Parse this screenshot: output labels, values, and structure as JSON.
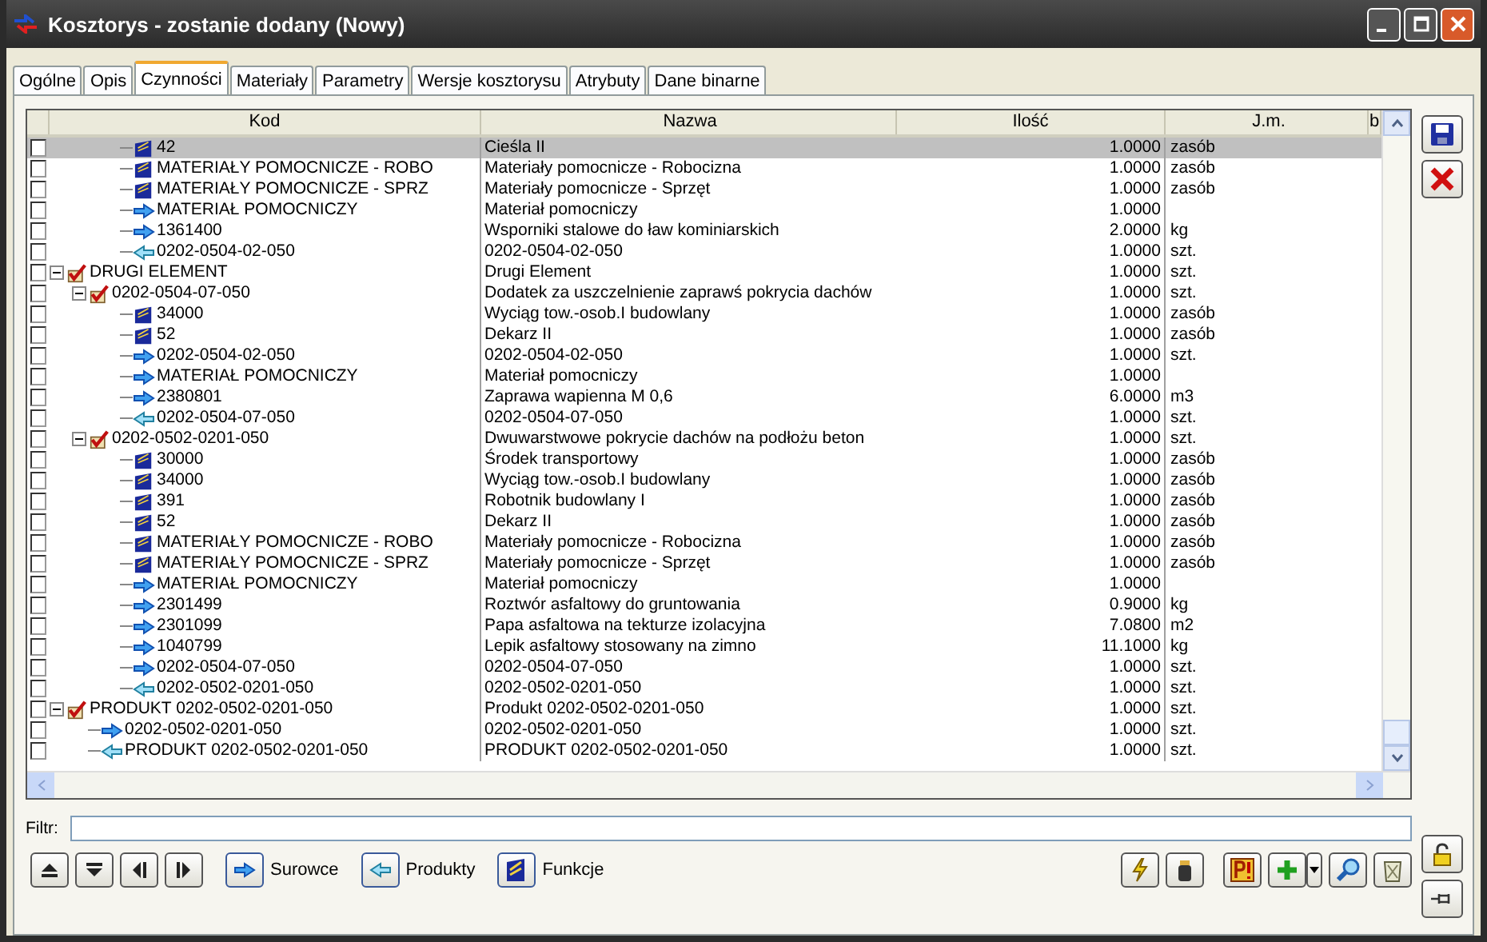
{
  "window": {
    "title": "Kosztorys - zostanie dodany  (Nowy)"
  },
  "tabs": [
    {
      "label": "Ogólne",
      "selected": false
    },
    {
      "label": "Opis",
      "selected": false
    },
    {
      "label": "Czynności",
      "selected": true
    },
    {
      "label": "Materiały",
      "selected": false
    },
    {
      "label": "Parametry",
      "selected": false
    },
    {
      "label": "Wersje kosztorysu",
      "selected": false
    },
    {
      "label": "Atrybuty",
      "selected": false
    },
    {
      "label": "Dane binarne",
      "selected": false
    }
  ],
  "table": {
    "columns": [
      "Kod",
      "Nazwa",
      "Ilość",
      "J.m.",
      "b"
    ],
    "rows": [
      {
        "children": [
          {
            "children": [
              {
                "kind": "resource",
                "kod": "42",
                "nazwa": "Cieśla II",
                "ilosc": "1.0000",
                "jm": "zasób",
                "checked": false,
                "selected": true
              },
              {
                "kind": "resource",
                "kod": "MATERIAŁY POMOCNICZE - ROBO",
                "nazwa": "Materiały pomocnicze - Robocizna",
                "ilosc": "1.0000",
                "jm": "zasób",
                "checked": false,
                "selected": false
              },
              {
                "kind": "resource",
                "kod": "MATERIAŁY POMOCNICZE - SPRZ",
                "nazwa": "Materiały pomocnicze - Sprzęt",
                "ilosc": "1.0000",
                "jm": "zasób",
                "checked": false,
                "selected": false
              },
              {
                "kind": "input",
                "kod": "MATERIAŁ POMOCNICZY",
                "nazwa": "Materiał pomocniczy",
                "ilosc": "1.0000",
                "checked": false,
                "selected": false
              },
              {
                "kind": "input",
                "kod": "1361400",
                "nazwa": "Wsporniki stalowe do ław kominiarskich",
                "ilosc": "2.0000",
                "jm": "kg",
                "checked": false,
                "selected": false
              },
              {
                "kind": "output",
                "kod": "0202-0504-02-050",
                "nazwa": "0202-0504-02-050",
                "ilosc": "1.0000",
                "jm": "szt.",
                "checked": false,
                "selected": false
              }
            ]
          }
        ]
      },
      {
        "kind": "element",
        "kod": "DRUGI ELEMENT",
        "nazwa": "Drugi Element",
        "ilosc": "1.0000",
        "jm": "szt.",
        "checked": false,
        "selected": false,
        "expanded": true,
        "children": [
          {
            "kind": "element",
            "kod": "0202-0504-07-050",
            "nazwa": "Dodatek za uszczelnienie zaprawś pokrycia dachów",
            "ilosc": "1.0000",
            "jm": "szt.",
            "checked": false,
            "selected": false,
            "expanded": true,
            "children": [
              {
                "kind": "resource",
                "kod": "34000",
                "nazwa": "Wyciąg tow.-osob.I budowlany",
                "ilosc": "1.0000",
                "jm": "zasób",
                "checked": false,
                "selected": false
              },
              {
                "kind": "resource",
                "kod": "52",
                "nazwa": "Dekarz II",
                "ilosc": "1.0000",
                "jm": "zasób",
                "checked": false,
                "selected": false
              },
              {
                "kind": "input",
                "kod": "0202-0504-02-050",
                "nazwa": "0202-0504-02-050",
                "ilosc": "1.0000",
                "jm": "szt.",
                "checked": false,
                "selected": false
              },
              {
                "kind": "input",
                "kod": "MATERIAŁ POMOCNICZY",
                "nazwa": "Materiał pomocniczy",
                "ilosc": "1.0000",
                "checked": false,
                "selected": false
              },
              {
                "kind": "input",
                "kod": "2380801",
                "nazwa": "Zaprawa wapienna M 0,6",
                "ilosc": "6.0000",
                "jm": "m3",
                "checked": false,
                "selected": false
              },
              {
                "kind": "output",
                "kod": "0202-0504-07-050",
                "nazwa": "0202-0504-07-050",
                "ilosc": "1.0000",
                "jm": "szt.",
                "checked": false,
                "selected": false
              }
            ]
          },
          {
            "kind": "element",
            "kod": "0202-0502-0201-050",
            "nazwa": "Dwuwarstwowe pokrycie dachów na podłożu beton",
            "ilosc": "1.0000",
            "jm": "szt.",
            "checked": false,
            "selected": false,
            "expanded": true,
            "children": [
              {
                "kind": "resource",
                "kod": "30000",
                "nazwa": "Środek transportowy",
                "ilosc": "1.0000",
                "jm": "zasób",
                "checked": false,
                "selected": false
              },
              {
                "kind": "resource",
                "kod": "34000",
                "nazwa": "Wyciąg tow.-osob.I budowlany",
                "ilosc": "1.0000",
                "jm": "zasób",
                "checked": false,
                "selected": false
              },
              {
                "kind": "resource",
                "kod": "391",
                "nazwa": "Robotnik budowlany I",
                "ilosc": "1.0000",
                "jm": "zasób",
                "checked": false,
                "selected": false
              },
              {
                "kind": "resource",
                "kod": "52",
                "nazwa": "Dekarz II",
                "ilosc": "1.0000",
                "jm": "zasób",
                "checked": false,
                "selected": false
              },
              {
                "kind": "resource",
                "kod": "MATERIAŁY POMOCNICZE - ROBO",
                "nazwa": "Materiały pomocnicze - Robocizna",
                "ilosc": "1.0000",
                "jm": "zasób",
                "checked": false,
                "selected": false
              },
              {
                "kind": "resource",
                "kod": "MATERIAŁY POMOCNICZE - SPRZ",
                "nazwa": "Materiały pomocnicze - Sprzęt",
                "ilosc": "1.0000",
                "jm": "zasób",
                "checked": false,
                "selected": false
              },
              {
                "kind": "input",
                "kod": "MATERIAŁ POMOCNICZY",
                "nazwa": "Materiał pomocniczy",
                "ilosc": "1.0000",
                "checked": false,
                "selected": false
              },
              {
                "kind": "input",
                "kod": "2301499",
                "nazwa": "Roztwór asfaltowy do gruntowania",
                "ilosc": "0.9000",
                "jm": "kg",
                "checked": false,
                "selected": false
              },
              {
                "kind": "input",
                "kod": "2301099",
                "nazwa": "Papa asfaltowa na tekturze izolacyjna",
                "ilosc": "7.0800",
                "jm": "m2",
                "checked": false,
                "selected": false
              },
              {
                "kind": "input",
                "kod": "1040799",
                "nazwa": "Lepik asfaltowy stosowany na zimno",
                "ilosc": "11.1000",
                "jm": "kg",
                "checked": false,
                "selected": false
              },
              {
                "kind": "input",
                "kod": "0202-0504-07-050",
                "nazwa": "0202-0504-07-050",
                "ilosc": "1.0000",
                "jm": "szt.",
                "checked": false,
                "selected": false
              },
              {
                "kind": "output",
                "kod": "0202-0502-0201-050",
                "nazwa": "0202-0502-0201-050",
                "ilosc": "1.0000",
                "jm": "szt.",
                "checked": false,
                "selected": false
              }
            ]
          }
        ]
      },
      {
        "kind": "element",
        "kod": "PRODUKT 0202-0502-0201-050",
        "nazwa": "Produkt 0202-0502-0201-050",
        "ilosc": "1.0000",
        "jm": "szt.",
        "checked": false,
        "selected": false,
        "expanded": true,
        "children": [
          {
            "kind": "input",
            "kod": "0202-0502-0201-050",
            "nazwa": "0202-0502-0201-050",
            "ilosc": "1.0000",
            "jm": "szt.",
            "checked": false,
            "selected": false
          },
          {
            "kind": "output",
            "kod": "PRODUKT 0202-0502-0201-050",
            "nazwa": "PRODUKT 0202-0502-0201-050",
            "ilosc": "1.0000",
            "jm": "szt.",
            "checked": false,
            "selected": false
          }
        ]
      }
    ]
  },
  "filter": {
    "label": "Filtr:"
  },
  "toolbar": {
    "surowce": "Surowce",
    "produkty": "Produkty",
    "funkcje": "Funkcje"
  }
}
